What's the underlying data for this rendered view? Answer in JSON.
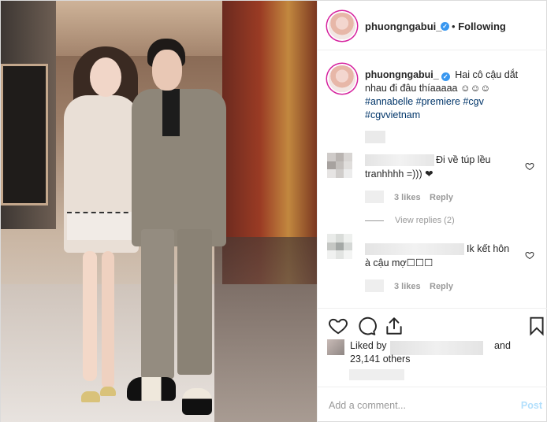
{
  "post": {
    "username": "phuongngabui_",
    "follow_dot": "•",
    "follow_state": "Following"
  },
  "caption": {
    "username": "phuongngabui_",
    "text": "Hai cô cậu dắt nhau đi đâu thíaaaaa ☺☺☺",
    "hashtags": [
      "#annabelle",
      "#premiere",
      "#cgv",
      "#cgvvietnam"
    ]
  },
  "comments": [
    {
      "text_line1": "Đi về túp lều",
      "text_line2": "tranhhhh =))) ❤",
      "likes": "3 likes",
      "reply": "Reply"
    },
    {
      "text_line1": "Ik kết hôn",
      "text_line2": "à cậu mợ☐☐☐",
      "likes": "3 likes",
      "reply": "Reply"
    }
  ],
  "view_replies": "View replies (2)",
  "likes_summary": {
    "liked_by": "Liked by",
    "and": "and",
    "count": "23,141 others"
  },
  "add_comment": {
    "placeholder": "Add a comment...",
    "post_label": "Post"
  },
  "colors": {
    "verified": "#3897f0",
    "hashtag": "#003569",
    "post_button_disabled": "#b2dffc",
    "muted": "#999999"
  },
  "icons": [
    "heart-icon",
    "comment-icon",
    "share-icon",
    "bookmark-icon",
    "verified-badge-icon"
  ]
}
